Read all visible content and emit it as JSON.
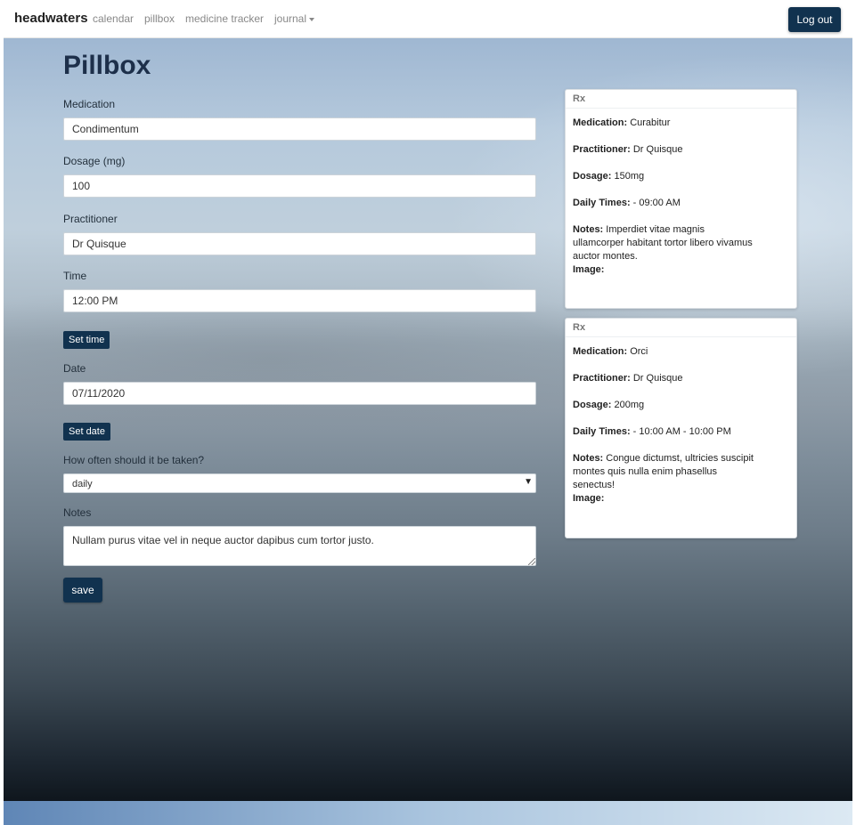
{
  "navbar": {
    "brand": "headwaters",
    "links": [
      "calendar",
      "pillbox",
      "medicine tracker",
      "journal"
    ],
    "logout_label": "Log out"
  },
  "page": {
    "title": "Pillbox"
  },
  "form": {
    "medication_label": "Medication",
    "medication_value": "Condimentum",
    "dosage_label": "Dosage (mg)",
    "dosage_value": "100",
    "practitioner_label": "Practitioner",
    "practitioner_value": "Dr Quisque",
    "time_label": "Time",
    "time_value": "12:00 PM",
    "set_time_label": "Set time",
    "date_label": "Date",
    "date_value": "07/11/2020",
    "set_date_label": "Set date",
    "frequency_label": "How often should it be taken?",
    "frequency_value": "daily",
    "notes_label": "Notes",
    "notes_value": "Nullam purus vitae vel in neque auctor dapibus cum tortor justo.",
    "save_label": "save"
  },
  "cards": [
    {
      "header": "Rx",
      "medication_key": "Medication:",
      "medication": "Curabitur",
      "practitioner_key": "Practitioner:",
      "practitioner": "Dr Quisque",
      "dosage_key": "Dosage:",
      "dosage": "150mg",
      "times_key": "Daily Times:",
      "times": "- 09:00 AM",
      "notes_key": "Notes:",
      "notes": "Imperdiet vitae magnis ullamcorper habitant tortor libero vivamus auctor montes.",
      "image_key": "Image:"
    },
    {
      "header": "Rx",
      "medication_key": "Medication:",
      "medication": "Orci",
      "practitioner_key": "Practitioner:",
      "practitioner": "Dr Quisque",
      "dosage_key": "Dosage:",
      "dosage": "200mg",
      "times_key": "Daily Times:",
      "times": "- 10:00 AM - 10:00 PM",
      "notes_key": "Notes:",
      "notes": "Congue dictumst, ultricies suscipit montes quis nulla enim phasellus senectus!",
      "image_key": "Image:"
    }
  ],
  "colors": {
    "accent": "#11324f",
    "title": "#1d2f4a"
  }
}
